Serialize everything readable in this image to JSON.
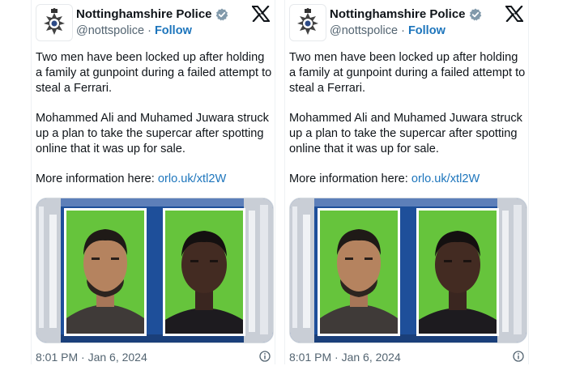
{
  "tweets": [
    {
      "account": {
        "name": "Nottinghamshire Police",
        "handle": "@nottspolice",
        "separator": "·",
        "follow": "Follow"
      },
      "body": {
        "para1": "Two men have been locked up after holding a family at gunpoint during a failed attempt to steal a Ferrari.",
        "para2": "Mohammed Ali and Muhamed Juwara struck up a plan to take the supercar after spotting online that it was up for sale.",
        "para3_prefix": "More information here: ",
        "para3_link": "orlo.uk/xtl2W"
      },
      "timestamp": "8:01 PM · Jan 6, 2024"
    },
    {
      "account": {
        "name": "Nottinghamshire Police",
        "handle": "@nottspolice",
        "separator": "·",
        "follow": "Follow"
      },
      "body": {
        "para1": "Two men have been locked up after holding a family at gunpoint during a failed attempt to steal a Ferrari.",
        "para2": "Mohammed Ali and Muhamed Juwara struck up a plan to take the supercar after spotting online that it was up for sale.",
        "para3_prefix": "More information here: ",
        "para3_link": "orlo.uk/xtl2W"
      },
      "timestamp": "8:01 PM · Jan 6, 2024"
    }
  ],
  "icons": {
    "avatar": "police-badge-icon",
    "verified": "verified-badge-icon",
    "platform": "x-logo-icon",
    "info": "info-icon"
  },
  "colors": {
    "link": "#1d75bc",
    "text": "#0f1419",
    "muted": "#536471",
    "verified": "#829aab",
    "photo_background": "#66c43c",
    "shelf_blue": "#1e4f9a"
  }
}
